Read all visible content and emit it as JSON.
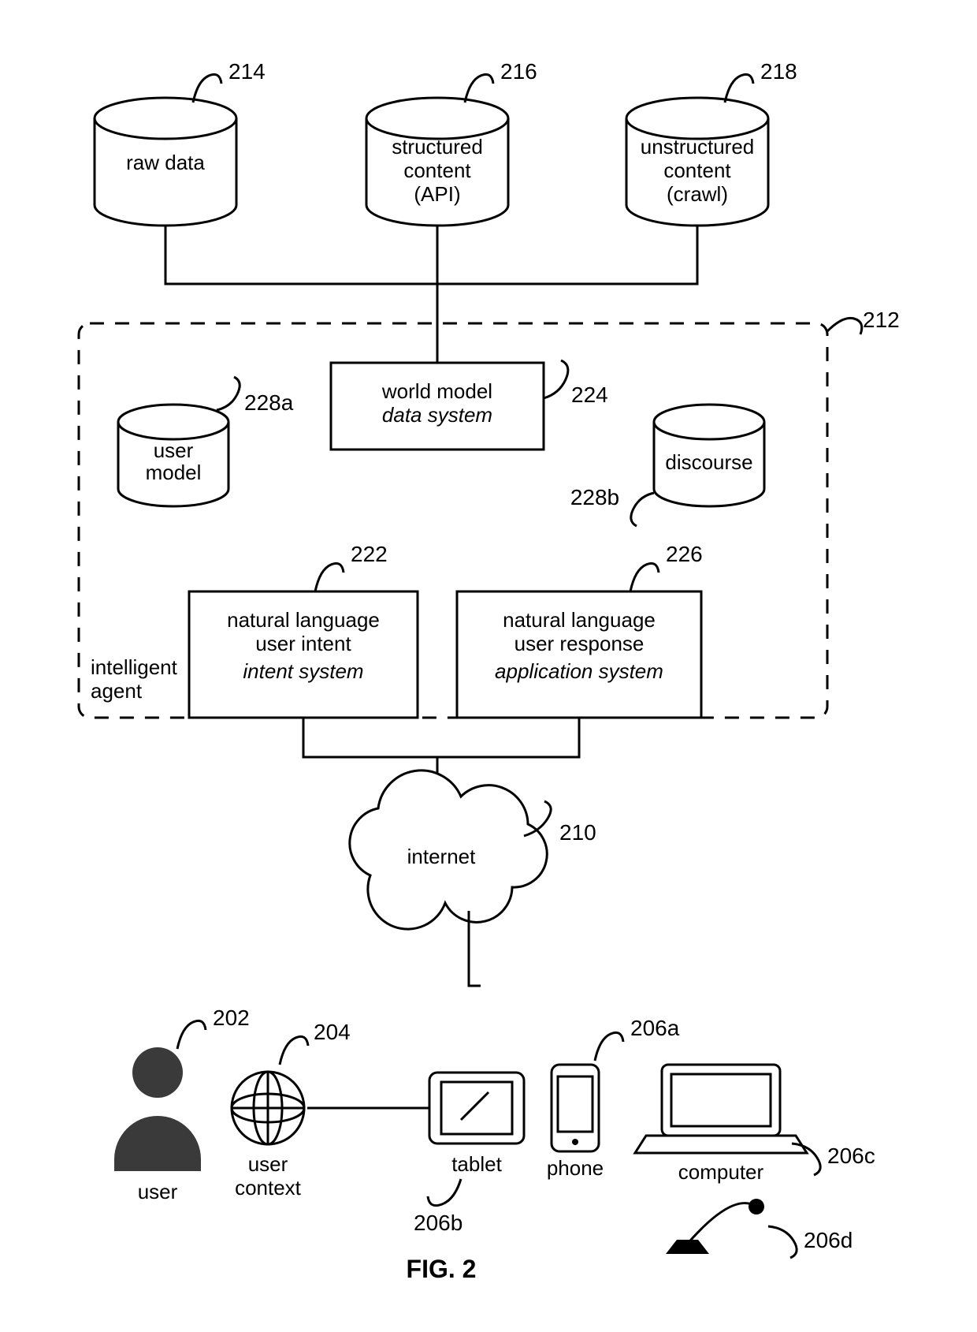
{
  "figure_label": "FIG. 2",
  "agent_box_label_line1": "intelligent",
  "agent_box_label_line2": "agent",
  "databases": {
    "raw": {
      "ref": "214",
      "label_lines": [
        "raw data"
      ]
    },
    "structured": {
      "ref": "216",
      "label_lines": [
        "structured",
        "content",
        "(API)"
      ]
    },
    "unstructured": {
      "ref": "218",
      "label_lines": [
        "unstructured",
        "content",
        "(crawl)"
      ]
    },
    "user_model": {
      "ref": "228a",
      "label_lines": [
        "user",
        "model"
      ]
    },
    "discourse": {
      "ref": "228b",
      "label_lines": [
        "discourse"
      ]
    }
  },
  "boxes": {
    "world_model": {
      "ref": "224",
      "title": "world model",
      "subtitle": "data system"
    },
    "intent": {
      "ref": "222",
      "title_lines": [
        "natural language",
        "user intent"
      ],
      "subtitle": "intent system"
    },
    "response": {
      "ref": "226",
      "title_lines": [
        "natural language",
        "user response"
      ],
      "subtitle": "application system"
    }
  },
  "agent_ref": "212",
  "cloud": {
    "ref": "210",
    "label": "internet"
  },
  "bottom": {
    "user": {
      "ref": "202",
      "label": "user"
    },
    "context": {
      "ref": "204",
      "label_lines": [
        "user",
        "context"
      ]
    },
    "tablet": {
      "ref": "206b",
      "label": "tablet"
    },
    "phone": {
      "ref": "206a",
      "label": "phone"
    },
    "computer": {
      "ref": "206c",
      "label": "computer"
    },
    "mic": {
      "ref": "206d"
    }
  }
}
